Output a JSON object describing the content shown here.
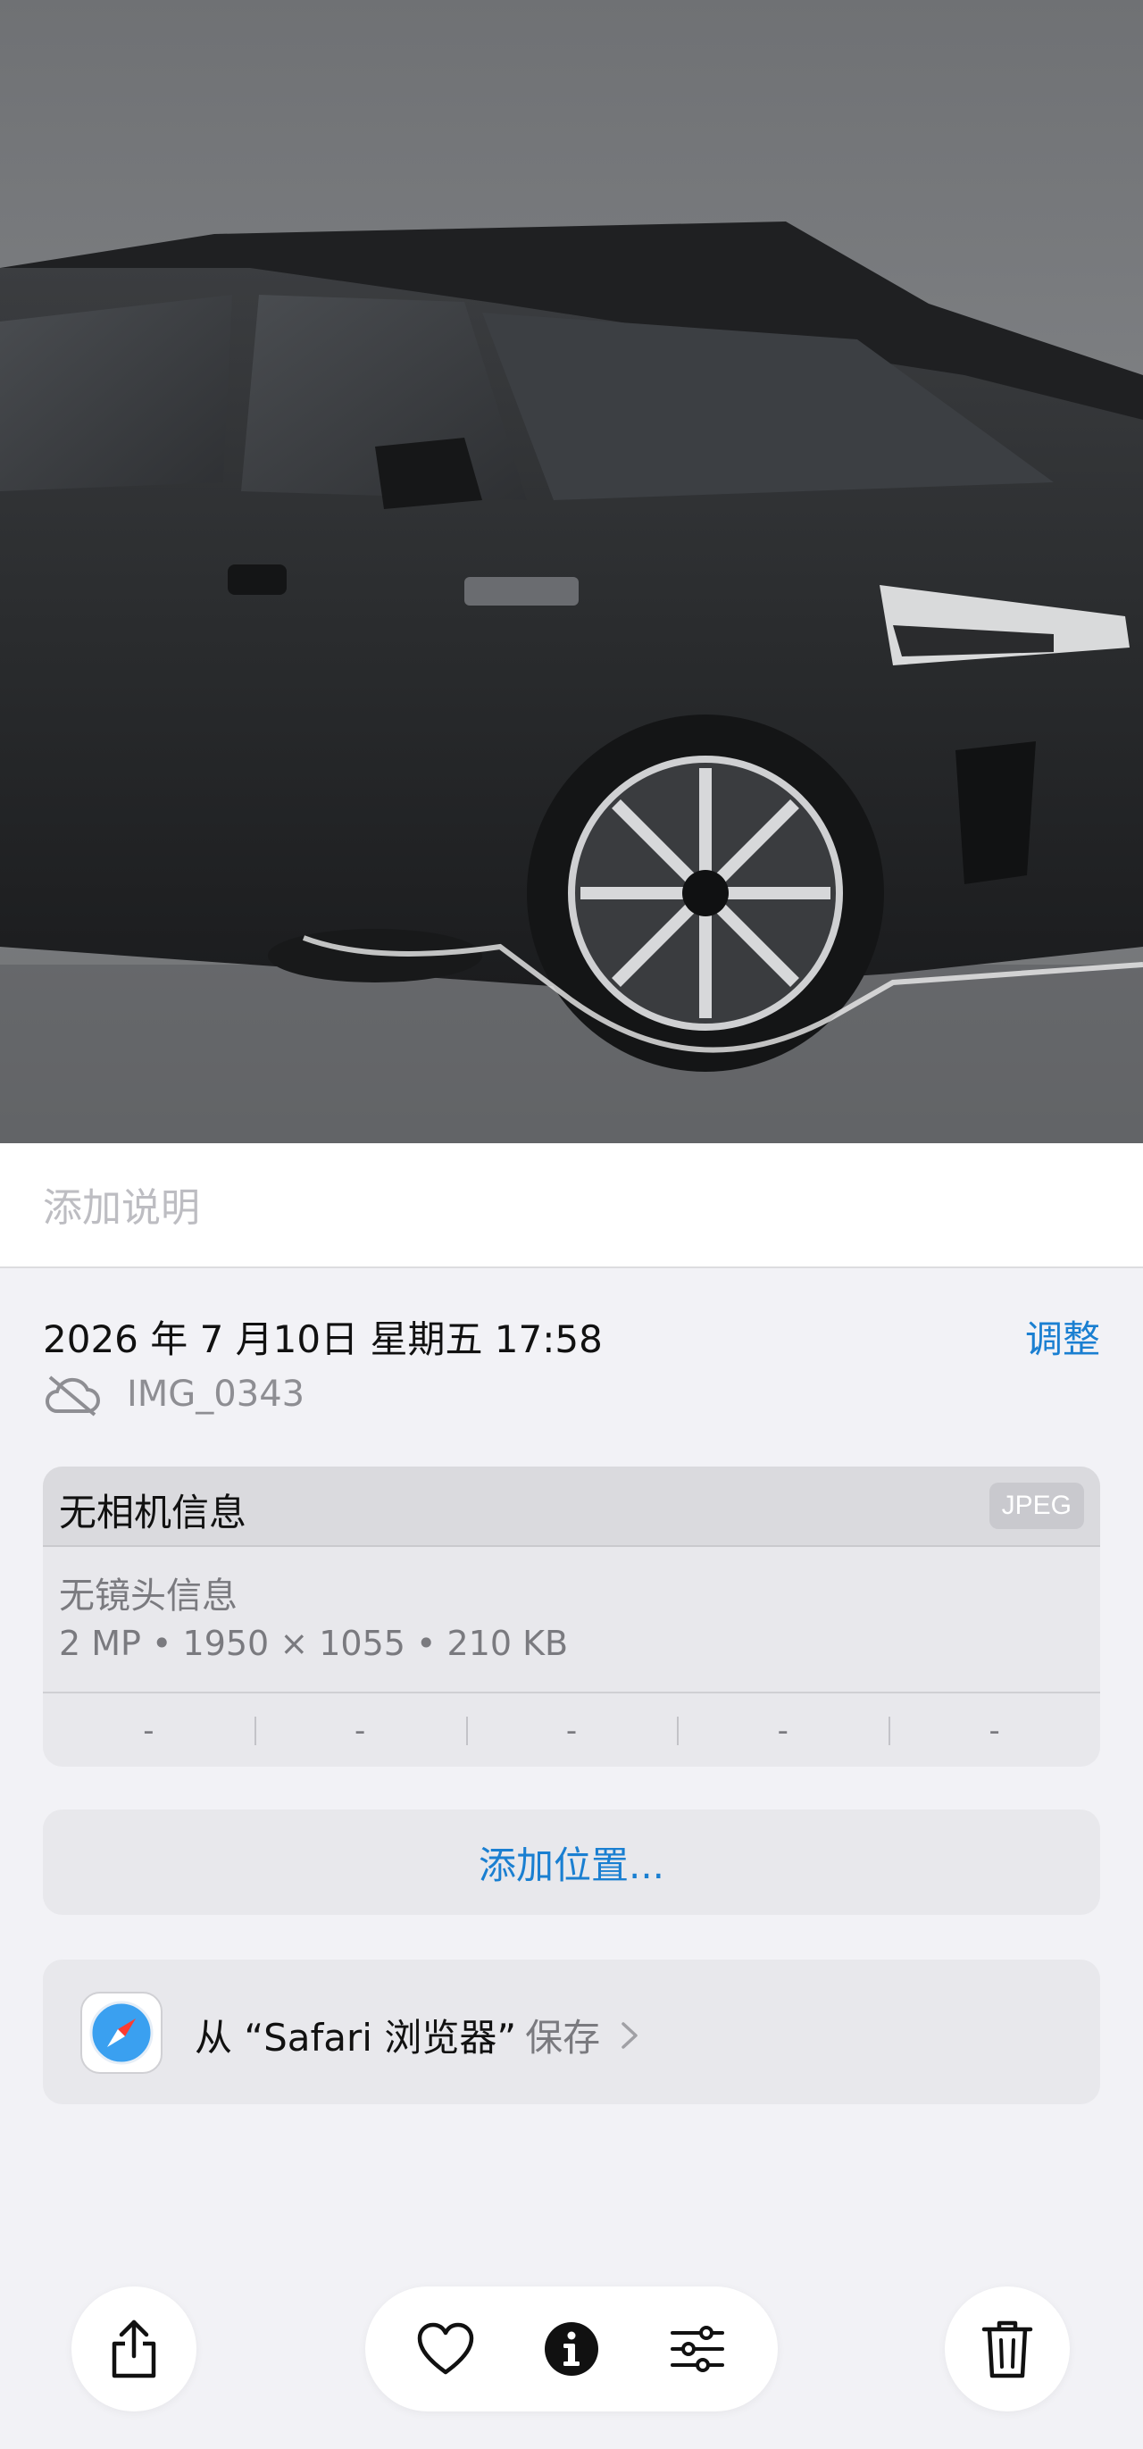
{
  "caption": {
    "placeholder": "添加说明"
  },
  "info": {
    "datetime": "2026 年 7 月10日 星期五 17:58",
    "adjust_label": "调整",
    "filename": "IMG_0343"
  },
  "camera": {
    "title": "无相机信息",
    "format_badge": "JPEG",
    "lens": "无镜头信息",
    "specs": "2 MP • 1950 × 1055 • 210 KB",
    "exif": [
      "-",
      "-",
      "-",
      "-",
      "-"
    ]
  },
  "location": {
    "label": "添加位置..."
  },
  "source": {
    "prefix": "从 “Safari 浏览器” ",
    "suffix": "保存"
  },
  "toolbar": {
    "share": "share-icon",
    "favorite": "heart-icon",
    "info": "info-icon",
    "edit": "sliders-icon",
    "delete": "trash-icon"
  },
  "colors": {
    "accent": "#1a7fd1",
    "background": "#f2f2f6"
  }
}
